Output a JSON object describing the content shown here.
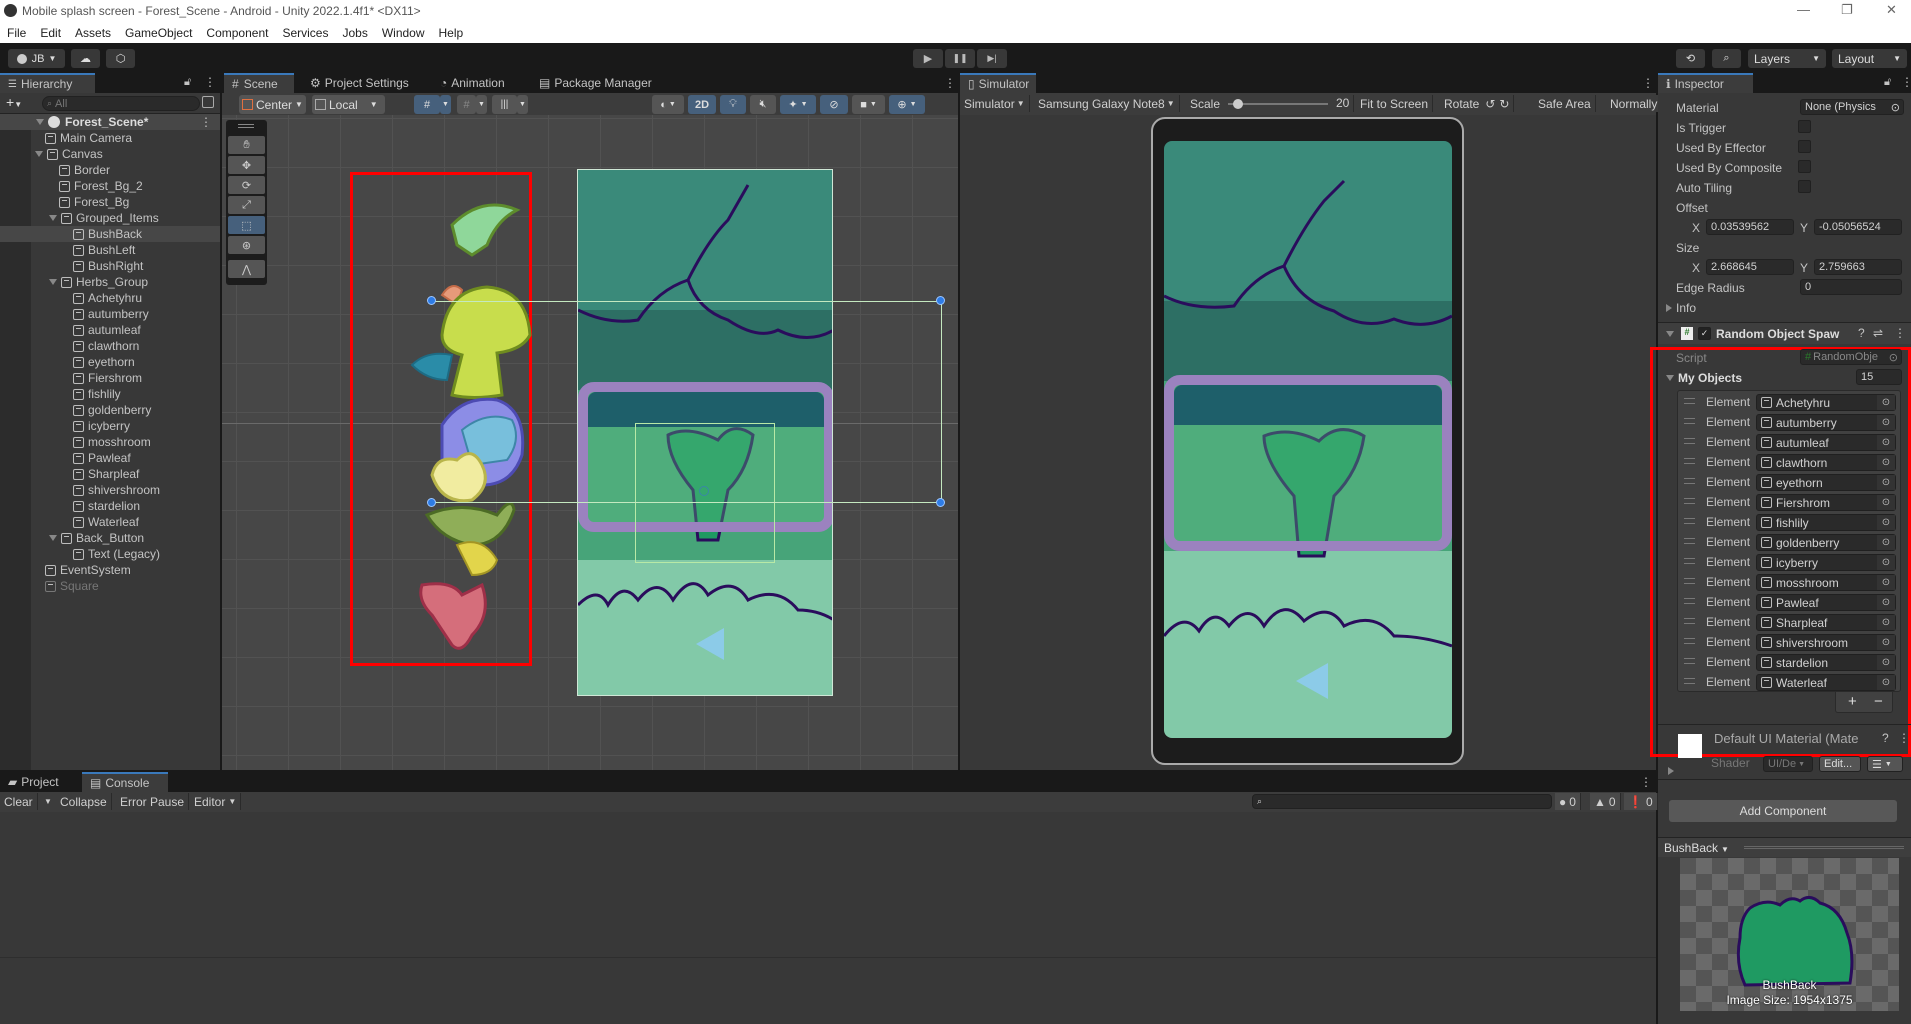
{
  "window": {
    "title": "Mobile splash screen - Forest_Scene - Android - Unity 2022.1.4f1* <DX11>",
    "controls": [
      "—",
      "❐",
      "✕"
    ]
  },
  "menu": [
    "File",
    "Edit",
    "Assets",
    "GameObject",
    "Component",
    "Services",
    "Jobs",
    "Window",
    "Help"
  ],
  "toolbar": {
    "account": "JB",
    "play_icon": "▶",
    "pause_icon": "❚❚",
    "step_icon": "▶|",
    "layers": "Layers",
    "layout": "Layout"
  },
  "hierarchy": {
    "tab": "Hierarchy",
    "search_placeholder": "All",
    "scene": "Forest_Scene*",
    "items": [
      {
        "label": "Main Camera",
        "depth": 1
      },
      {
        "label": "Canvas",
        "depth": 1,
        "expanded": true
      },
      {
        "label": "Border",
        "depth": 2
      },
      {
        "label": "Forest_Bg_2",
        "depth": 2
      },
      {
        "label": "Forest_Bg",
        "depth": 2
      },
      {
        "label": "Grouped_Items",
        "depth": 2,
        "expanded": true
      },
      {
        "label": "BushBack",
        "depth": 3,
        "selected": true
      },
      {
        "label": "BushLeft",
        "depth": 3
      },
      {
        "label": "BushRight",
        "depth": 3
      },
      {
        "label": "Herbs_Group",
        "depth": 2,
        "expanded": true
      },
      {
        "label": "Achetyhru",
        "depth": 3
      },
      {
        "label": "autumberry",
        "depth": 3
      },
      {
        "label": "autumleaf",
        "depth": 3
      },
      {
        "label": "clawthorn",
        "depth": 3
      },
      {
        "label": "eyethorn",
        "depth": 3
      },
      {
        "label": "Fiershrom",
        "depth": 3
      },
      {
        "label": "fishlily",
        "depth": 3
      },
      {
        "label": "goldenberry",
        "depth": 3
      },
      {
        "label": "icyberry",
        "depth": 3
      },
      {
        "label": "mosshroom",
        "depth": 3
      },
      {
        "label": "Pawleaf",
        "depth": 3
      },
      {
        "label": "Sharpleaf",
        "depth": 3
      },
      {
        "label": "shivershroom",
        "depth": 3
      },
      {
        "label": "stardelion",
        "depth": 3
      },
      {
        "label": "Waterleaf",
        "depth": 3
      },
      {
        "label": "Back_Button",
        "depth": 2,
        "expanded": true
      },
      {
        "label": "Text (Legacy)",
        "depth": 3
      },
      {
        "label": "EventSystem",
        "depth": 1
      },
      {
        "label": "Square",
        "depth": 1,
        "disabled": true
      }
    ]
  },
  "scene_view": {
    "tabs": [
      "Scene",
      "Project Settings",
      "Animation",
      "Package Manager"
    ],
    "pivot": "Center",
    "space": "Local",
    "mode_2d": "2D"
  },
  "simulator": {
    "tab": "Simulator",
    "mode": "Simulator",
    "device": "Samsung Galaxy Note8",
    "scale_label": "Scale",
    "scale_value": "20",
    "scale_fraction": 0.1,
    "fit": "Fit to Screen",
    "rotate": "Rotate",
    "safe_area": "Safe Area",
    "normally": "Normally"
  },
  "inspector": {
    "tab": "Inspector",
    "material_label": "Material",
    "material_value": "None (Physics",
    "checkboxes": [
      "Is Trigger",
      "Used By Effector",
      "Used By Composite",
      "Auto Tiling"
    ],
    "offset_label": "Offset",
    "offset_x": "0.03539562",
    "offset_y": "-0.05056524",
    "size_label": "Size",
    "size_x": "2.668645",
    "size_y": "2.759663",
    "edge_radius_label": "Edge Radius",
    "edge_radius": "0",
    "info_label": "Info",
    "component_title": "Random Object Spaw",
    "script_label": "Script",
    "script_value": "RandomObje",
    "list_label": "My Objects",
    "list_count": "15",
    "element_label": "Element",
    "elements": [
      "Achetyhru",
      "autumberry",
      "autumleaf",
      "clawthorn",
      "eyethorn",
      "Fiershrom",
      "fishlily",
      "goldenberry",
      "icyberry",
      "mosshroom",
      "Pawleaf",
      "Sharpleaf",
      "shivershroom",
      "stardelion",
      "Waterleaf"
    ],
    "add_icon": "+",
    "remove_icon": "−",
    "material_name": "Default UI Material (Mate",
    "shader_label": "Shader",
    "shader_value": "UI/De",
    "edit_btn": "Edit...",
    "add_component": "Add Component",
    "preview_title": "BushBack",
    "preview_name": "BushBack",
    "preview_size": "Image Size: 1954x1375"
  },
  "console": {
    "tabs": [
      "Project",
      "Console"
    ],
    "clear": "Clear",
    "collapse": "Collapse",
    "error_pause": "Error Pause",
    "editor": "Editor",
    "counts": {
      "logs": "0",
      "warnings": "0",
      "errors": "0"
    }
  },
  "colors": {
    "accent": "#3a79bb",
    "selection_red": "#ff0000",
    "forest_dark": "#2f7a6c",
    "forest_light": "#5dc184",
    "frame_purple": "#9b82bf"
  }
}
